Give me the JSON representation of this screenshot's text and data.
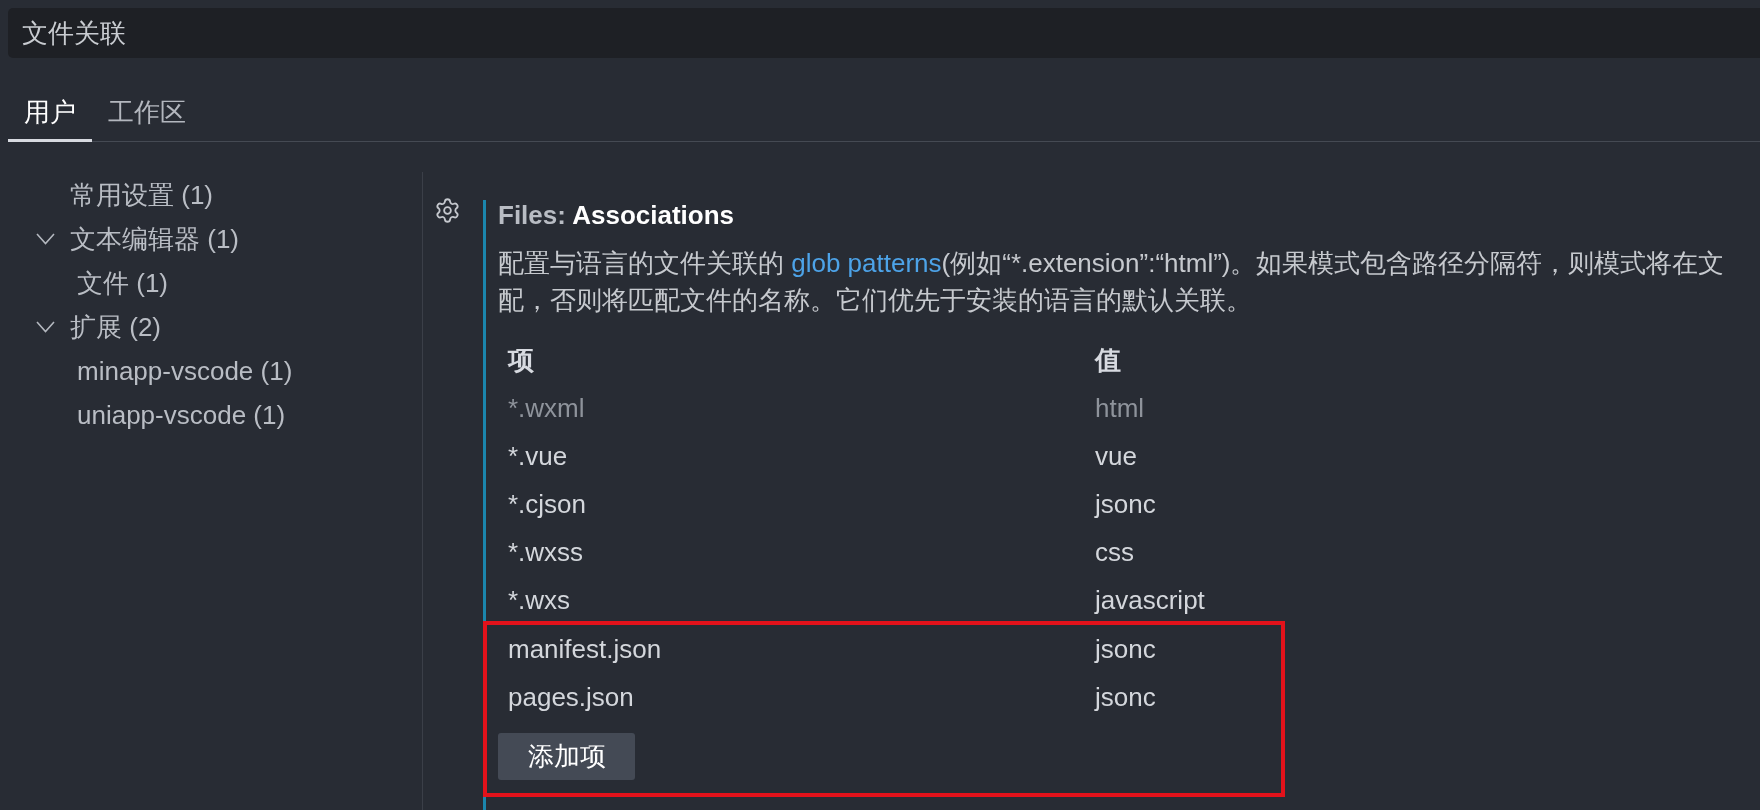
{
  "search": {
    "value": "文件关联"
  },
  "tabs": [
    {
      "label": "用户",
      "selected": true
    },
    {
      "label": "工作区",
      "selected": false
    }
  ],
  "sidebar": {
    "items": [
      {
        "label": "常用设置 (1)"
      },
      {
        "label": "文本编辑器 (1)",
        "expanded": true,
        "children": [
          {
            "label": "文件 (1)"
          }
        ]
      },
      {
        "label": "扩展 (2)",
        "expanded": true,
        "children": [
          {
            "label": "minapp-vscode (1)"
          },
          {
            "label": "uniapp-vscode (1)"
          }
        ]
      }
    ]
  },
  "setting": {
    "category": "Files:",
    "name": "Associations",
    "description": [
      {
        "parts": [
          {
            "kind": "text",
            "text": "配置与语言的文件关联的 "
          },
          {
            "kind": "link",
            "text": "glob patterns"
          },
          {
            "kind": "text",
            "text": "(例如“*.extension”:“html”)。如果模式包含路径分隔符，则模式将在文"
          }
        ]
      },
      {
        "parts": [
          {
            "kind": "text",
            "text": "配，否则将匹配文件的名称。它们优先于安装的语言的默认关联。"
          }
        ]
      }
    ],
    "table": {
      "columns": [
        "项",
        "值"
      ],
      "rows": [
        {
          "key": "*.wxml",
          "value": "html",
          "dimmed": true,
          "highlighted": false
        },
        {
          "key": "*.vue",
          "value": "vue",
          "dimmed": false,
          "highlighted": false
        },
        {
          "key": "*.cjson",
          "value": "jsonc",
          "dimmed": false,
          "highlighted": false
        },
        {
          "key": "*.wxss",
          "value": "css",
          "dimmed": false,
          "highlighted": false
        },
        {
          "key": "*.wxs",
          "value": "javascript",
          "dimmed": false,
          "highlighted": false
        },
        {
          "key": "manifest.json",
          "value": "jsonc",
          "dimmed": false,
          "highlighted": true
        },
        {
          "key": "pages.json",
          "value": "jsonc",
          "dimmed": false,
          "highlighted": true
        }
      ],
      "add_button": {
        "label": "添加项",
        "highlighted": true
      }
    }
  }
}
